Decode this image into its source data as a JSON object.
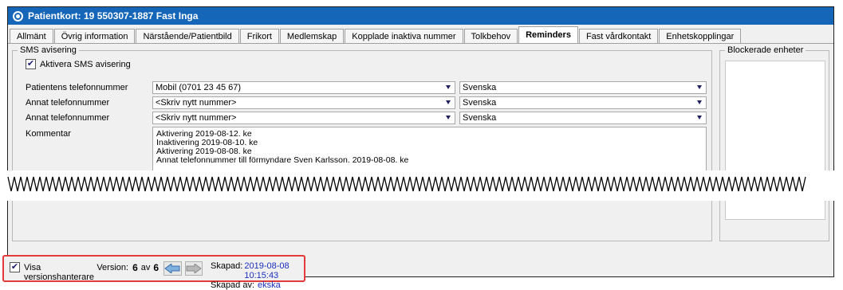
{
  "window": {
    "title": "Patientkort: 19 550307-1887 Fast Inga"
  },
  "tabs": [
    {
      "label": "Allmänt"
    },
    {
      "label": "Övrig information"
    },
    {
      "label": "Närstående/Patientbild"
    },
    {
      "label": "Frikort"
    },
    {
      "label": "Medlemskap"
    },
    {
      "label": "Kopplade inaktiva nummer"
    },
    {
      "label": "Tolkbehov"
    },
    {
      "label": "Reminders",
      "active": true
    },
    {
      "label": "Fast vårdkontakt"
    },
    {
      "label": "Enhetskopplingar"
    }
  ],
  "sms": {
    "group_title": "SMS avisering",
    "activate_label": "Aktivera SMS avisering",
    "activate_checked": true,
    "rows": [
      {
        "label": "Patientens telefonnummer",
        "number": "Mobil (0701 23 45 67)",
        "language": "Svenska"
      },
      {
        "label": "Annat telefonnummer",
        "number": "<Skriv nytt nummer>",
        "language": "Svenska"
      },
      {
        "label": "Annat telefonnummer",
        "number": "<Skriv nytt nummer>",
        "language": "Svenska"
      }
    ],
    "comment_label": "Kommentar",
    "comment_lines": [
      "Aktivering 2019-08-12.  ke",
      "Inaktivering 2019-08-10.  ke",
      "Aktivering 2019-08-08.  ke",
      "Annat telefonnummer till förmyndare Sven Karlsson.  2019-08-08.  ke"
    ]
  },
  "blocked": {
    "group_title": "Blockerade enheter"
  },
  "versioning": {
    "show_label": "Visa versionshanterare",
    "show_checked": true,
    "version_label": "Version:",
    "current": "6",
    "of_label": "av",
    "total": "6",
    "created_label": "Skapad:",
    "created_value": "2019-08-08 10:15:43",
    "created_by_label": "Skapad av:",
    "created_by_value": "ekska"
  },
  "colors": {
    "titlebar": "#1565b8",
    "highlight_border": "#e33a3a",
    "link": "#1a2fbd"
  }
}
